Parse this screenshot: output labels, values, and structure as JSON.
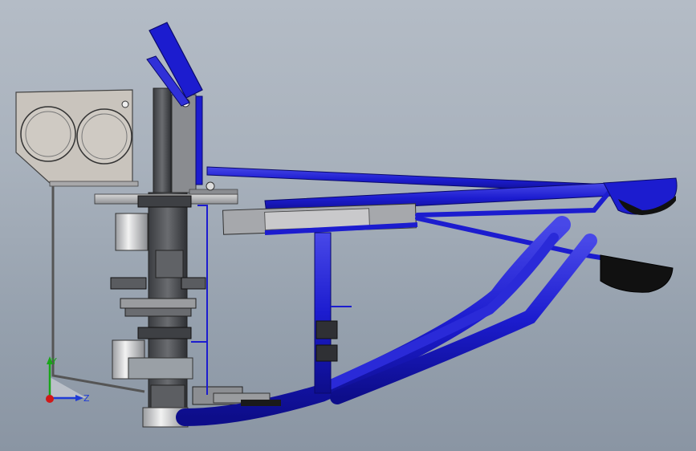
{
  "viewport": {
    "background_top": "#b4bcc6",
    "background_bottom": "#8a95a3"
  },
  "model": {
    "frame_color": "#1c1ccf",
    "frame_highlight": "#5a5af0",
    "frame_shadow": "#0d0d8a",
    "metal_color": "#8a8d92",
    "metal_light": "#d6d6d6",
    "dark_metal": "#4a4c50",
    "bracket_color": "#c9c4bd"
  },
  "triad": {
    "y_label": "Y",
    "z_label": "Z",
    "y_color": "#19a619",
    "z_color": "#1f3bd6",
    "origin_color": "#d11818"
  }
}
